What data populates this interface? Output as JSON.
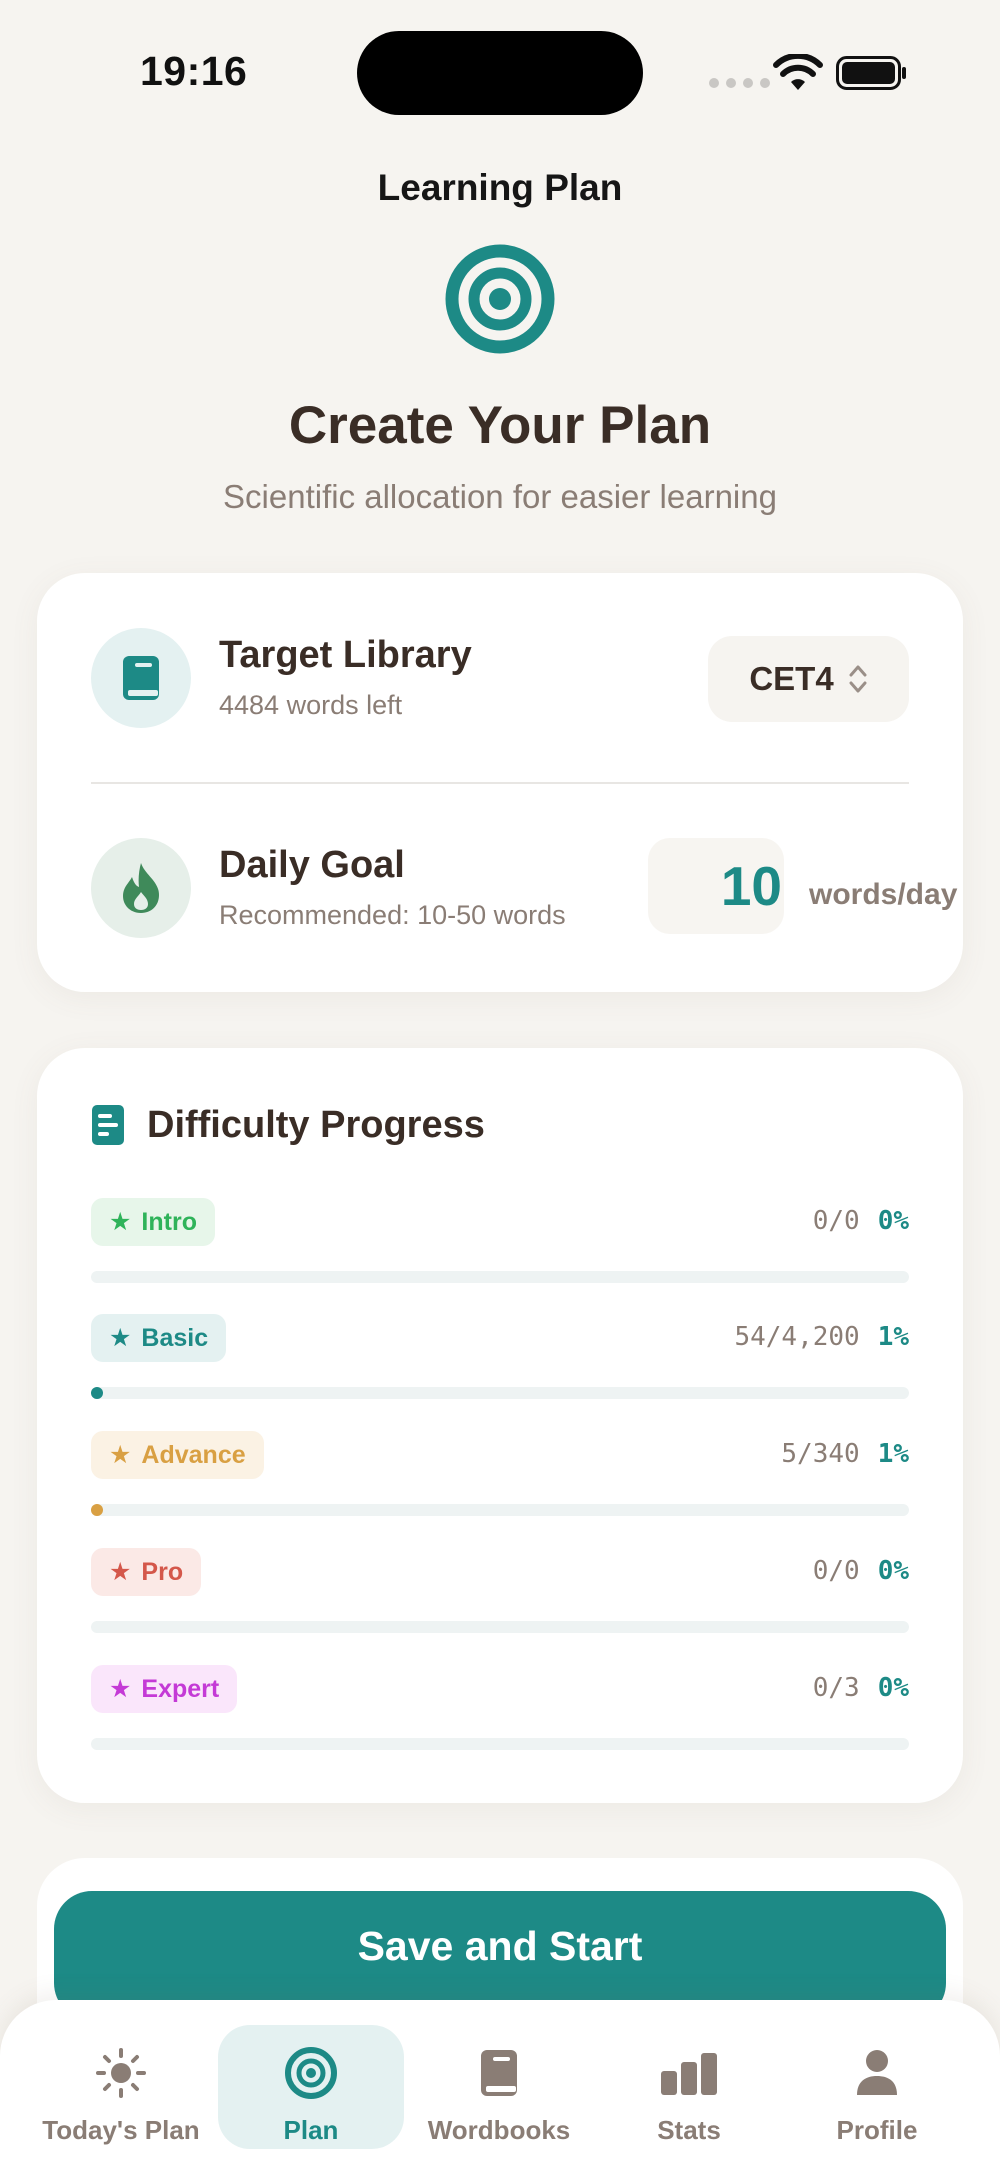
{
  "status_bar": {
    "time": "19:16"
  },
  "nav": {
    "title": "Learning Plan"
  },
  "hero": {
    "icon": "target-icon",
    "title": "Create Your Plan",
    "subtitle": "Scientific allocation for easier learning"
  },
  "settings": {
    "library": {
      "icon": "book-icon",
      "title": "Target Library",
      "subtitle": "4484 words left",
      "value": "CET4"
    },
    "goal": {
      "icon": "flame-icon",
      "title": "Daily Goal",
      "subtitle": "Recommended: 10-50 words",
      "value": "10",
      "unit": "words/day"
    }
  },
  "difficulty": {
    "icon": "document-icon",
    "title": "Difficulty Progress",
    "levels": [
      {
        "label": "Intro",
        "count": "0/0",
        "percent": "0%",
        "progress": 0,
        "color": "#2fb35a",
        "bg": "#e7f6ea"
      },
      {
        "label": "Basic",
        "count": "54/4,200",
        "percent": "1%",
        "progress": 0.01,
        "color": "#1d8a86",
        "bg": "#e4f1f1"
      },
      {
        "label": "Advance",
        "count": "5/340",
        "percent": "1%",
        "progress": 0.01,
        "color": "#d9a043",
        "bg": "#fbf2e4"
      },
      {
        "label": "Pro",
        "count": "0/0",
        "percent": "0%",
        "progress": 0,
        "color": "#d4574a",
        "bg": "#fbe9e6"
      },
      {
        "label": "Expert",
        "count": "0/3",
        "percent": "0%",
        "progress": 0,
        "color": "#c43ad6",
        "bg": "#fae6fb"
      }
    ]
  },
  "actions": {
    "save_label": "Save and Start"
  },
  "tabs": [
    {
      "label": "Today's Plan",
      "icon": "sun-icon",
      "active": false
    },
    {
      "label": "Plan",
      "icon": "target-icon",
      "active": true
    },
    {
      "label": "Wordbooks",
      "icon": "book-icon",
      "active": false
    },
    {
      "label": "Stats",
      "icon": "bar-chart-icon",
      "active": false
    },
    {
      "label": "Profile",
      "icon": "person-icon",
      "active": false
    }
  ],
  "colors": {
    "accent": "#1d8a86",
    "background": "#f6f4f0",
    "text_primary": "#3a2d26",
    "text_secondary": "#8a7d75"
  }
}
